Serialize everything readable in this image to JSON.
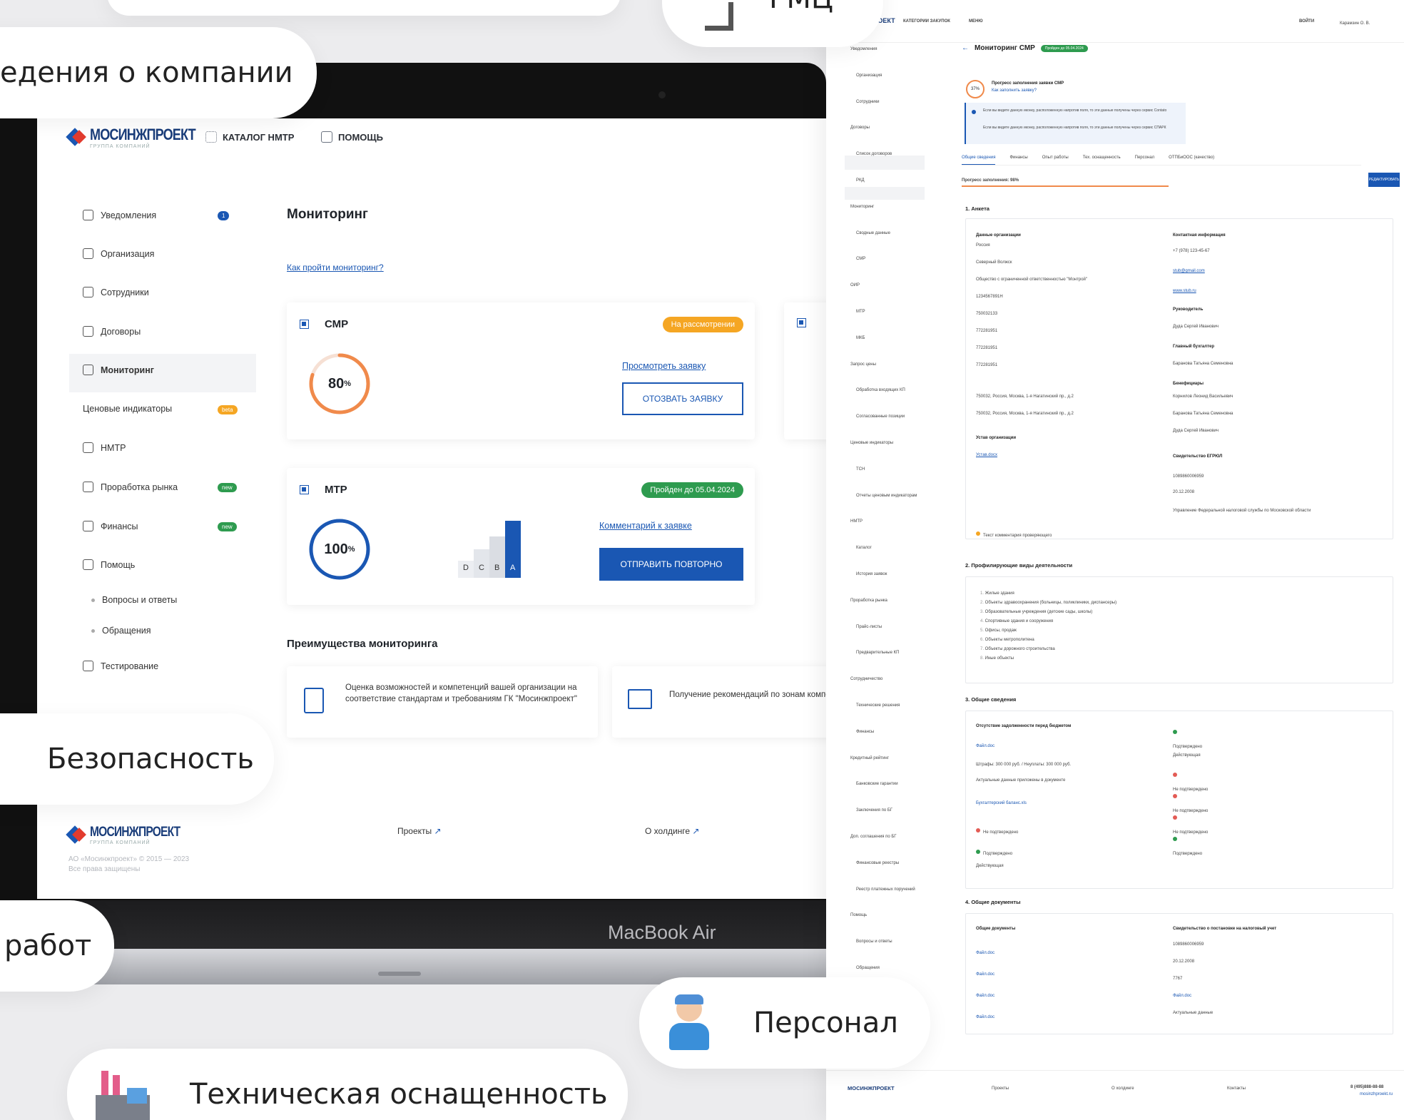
{
  "pills": {
    "company": "едения о компании",
    "gmc": "ГМЦ",
    "security": "Безопасность",
    "works": "работ",
    "personnel": "Персонал",
    "tech": "Техническая оснащенность"
  },
  "laptop": {
    "label": "MacBook Air"
  },
  "header": {
    "logo": "МОСИНЖПРОЕКТ",
    "logo_sub": "ГРУППА КОМПАНИЙ",
    "nav_catalog": "КАТАЛОГ НМТР",
    "nav_help": "ПОМОЩЬ"
  },
  "sidebar": {
    "items": [
      {
        "label": "Уведомления",
        "badge": "1"
      },
      {
        "label": "Организация"
      },
      {
        "label": "Сотрудники"
      },
      {
        "label": "Договоры"
      },
      {
        "label": "Мониторинг"
      },
      {
        "label": "Ценовые индикаторы",
        "badge": "beta"
      },
      {
        "label": "НМТР"
      },
      {
        "label": "Проработка рынка",
        "badge": "new"
      },
      {
        "label": "Финансы",
        "badge": "new"
      },
      {
        "label": "Помощь"
      },
      {
        "label": "Вопросы и ответы"
      },
      {
        "label": "Обращения"
      },
      {
        "label": "Тестирование"
      }
    ]
  },
  "main": {
    "title": "Мониторинг",
    "how_link": "Как пройти мониторинг?",
    "cards": [
      {
        "title": "СМР",
        "status": "На рассмотрении",
        "progress": 80,
        "progress_label": "80",
        "link": "Просмотреть заявку",
        "button": "ОТОЗВАТЬ ЗАЯВКУ"
      },
      {
        "title": "МТР",
        "status": "Пройден до 05.04.2024",
        "progress": 100,
        "progress_label": "100",
        "link": "Комментарий к заявке",
        "button": "ОТПРАВИТЬ ПОВТОРНО",
        "grades": [
          "D",
          "C",
          "B",
          "A"
        ]
      }
    ],
    "advantages_title": "Преимущества мониторинга",
    "advantages": [
      "Оценка возможностей и компетенций вашей организации на соответствие стандартам и требованиям ГК \"Мосинжпроект\"",
      "Получение рекомендаций по зонам компетенций по результатам монито"
    ]
  },
  "footer": {
    "copyright": "АО «Мосинжпроект» © 2015 — 2023",
    "rights": "Все права защищены",
    "projects": "Проекты",
    "holding": "О холдинге"
  },
  "right": {
    "header": {
      "logo": "ПРОЕКТ",
      "nav1": "КАТЕГОРИИ ЗАКУПОК",
      "nav2": "МЕНЮ",
      "login": "ВОЙТИ",
      "user": "Карамзин О. В."
    },
    "title": "Мониторинг СМР",
    "title_badge": "Пройден до 05.04.2024",
    "progress_small": "37",
    "fill_title": "Прогресс заполнения заявки СМР",
    "fill_link": "Как заполнить заявку?",
    "notice1": "Если вы видите данную иконку, расположенную напротив поля, то эти данные получены через сервис Contato",
    "notice2": "Если вы видите данную иконку, расположенную напротив поля, то эти данные получены через сервис СПАРК",
    "tabs": [
      "Общие сведения",
      "Финансы",
      "Опыт работы",
      "Тех. оснащенность",
      "Персонал",
      "ОТПБиООС (качество)"
    ],
    "progress_text": "Прогресс заполнения: 98%",
    "edit_button": "РЕДАКТИРОВАТЬ",
    "sidebar": [
      "Уведомления",
      "Организация",
      "Сотрудники",
      "Договоры",
      "Список договоров",
      "РКД",
      "Мониторинг",
      "Сводные данные",
      "СМР",
      "ОИР",
      "МТР",
      "МКБ",
      "Запрос цены",
      "Обработка входящих КП",
      "Согласованные позиции",
      "Ценовые индикаторы",
      "ТСН",
      "Отчеты ценовым индикаторам",
      "НМТР",
      "Каталог",
      "История заявок",
      "Проработка рынка",
      "Прайс-листы",
      "Предварительные КП",
      "Сотрудничество",
      "Технические решения",
      "Финансы",
      "Кредитный рейтинг",
      "Банковские гарантии",
      "Заключения по БГ",
      "Доп. соглашения по БГ",
      "Финансовые реестры",
      "Реестр платежных поручений",
      "Помощь",
      "Вопросы и ответы",
      "Обращения",
      "Тестирование"
    ],
    "s1_title": "1. Анкета",
    "org_head": "Данные организации",
    "contact_head": "Контактная информация",
    "org_lines": [
      "Россия",
      "Северный Волжск",
      "Общество с ограниченной ответственностью \"Монтрой\"",
      "1234567891Н",
      "750032133",
      "772281951",
      "772281951",
      "772281951",
      "750032, Россия, Москва, 1-я Нагатинский пр., д.2",
      "750032, Россия, Москва, 1-я Нагатинский пр., д.2"
    ],
    "contact_lines": [
      "+7 (978) 123-45-67",
      "stub@gmail.com",
      "www.stub.ru"
    ],
    "head_rukov": "Руководитель",
    "rukov_name": "Дуда Сергей Иванович",
    "head_buh": "Главный бухгалтер",
    "buh_name": "Баранова Татьяна Семеновна",
    "head_benef": "Бенефициары",
    "benef": [
      "Корнилов Леонид Васильевич",
      "Баранова Татьяна Семеновна",
      "Дуда Сергей Иванович"
    ],
    "ustav": "Устав организации",
    "ustav_file": "Устав.docx",
    "egrul": "Свидетельство ЕГРЮЛ",
    "egrul_lines": [
      "1089860006959",
      "20.12.2008",
      "Управление Федеральной налоговой службы по Московской области"
    ],
    "comment": "Текст комментария проверяющего",
    "s2_title": "2. Профилирующие виды деятельности",
    "activities": [
      "Жилые здания",
      "Объекты здравоохранения (больницы, поликлиники, диспансеры)",
      "Образовательные учреждения (детские сады, школы)",
      "Спортивные здания и сооружения",
      "Офисы, продаж",
      "Объекты метрополитена",
      "Объекты дорожного строительства",
      "Иные объекты"
    ],
    "s3_title": "3. Общие сведения",
    "s3_lines": [
      "Отсутствие задолженности перед бюджетом",
      "Файл.doc",
      "Штрафы: 300 000 руб. / Неуплаты: 300 000 руб.",
      "Актуальные данные приложены в документе",
      "Бухгалтерский баланс.xls",
      "Не подтверждено",
      "Подтверждено",
      "Действующая"
    ],
    "s3_right": [
      "Подтверждено",
      "Действующая",
      "Не подтверждено",
      "Не подтверждено",
      "Не подтверждено",
      "Подтверждено"
    ],
    "s4_title": "4. Общие документы",
    "docs_head": "Общие документы",
    "tax_head": "Свидетельство о постановке на налоговый учет",
    "doc_file": "Файл.doc",
    "tax_lines": [
      "1089860006959",
      "20.12.2008",
      "7767",
      "Файл.doc",
      "Актуальные данные"
    ],
    "footer": {
      "proj": "Проекты",
      "hold": "О холдинге",
      "cont": "Контакты",
      "phone": "8 (495)888-88-88",
      "site": "mosinzhproekt.ru"
    }
  },
  "colors": {
    "brand_blue": "#1a57b3",
    "orange": "#f5a623",
    "green": "#2e9b4f",
    "red": "#e35b55"
  }
}
